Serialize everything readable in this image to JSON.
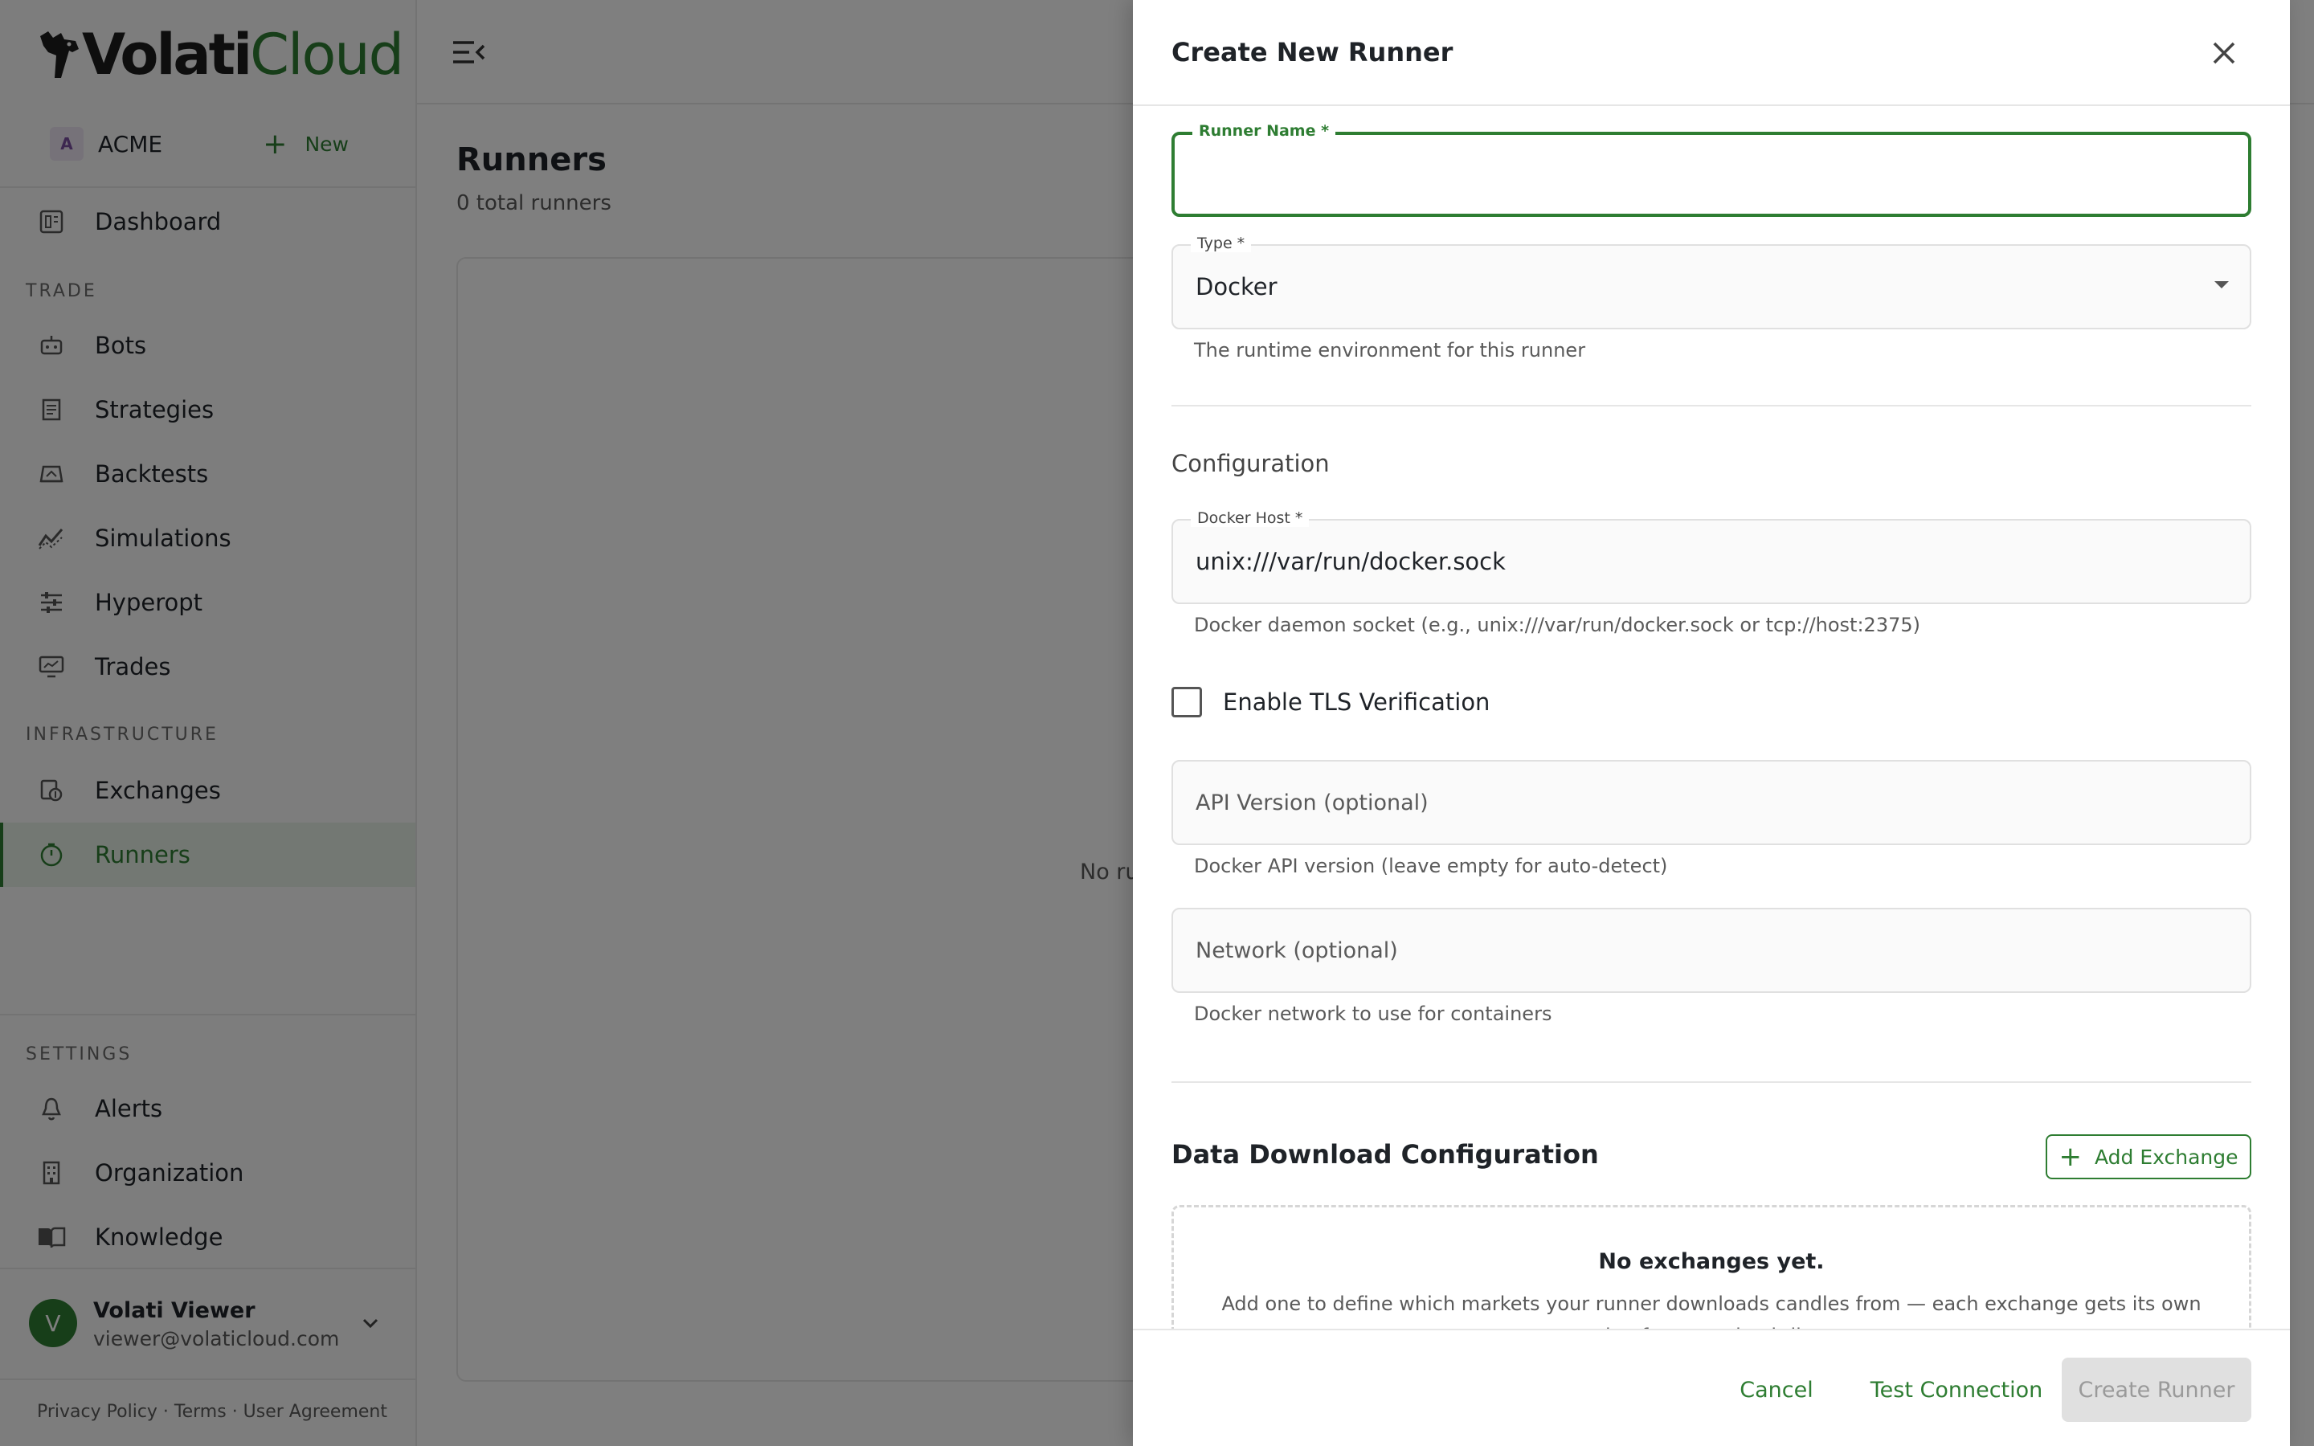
{
  "app": {
    "logo_bold": "Volati",
    "logo_light": "Cloud"
  },
  "org": {
    "avatar_letter": "A",
    "name": "ACME",
    "new_label": "New"
  },
  "sidebar": {
    "dashboard": "Dashboard",
    "trade_label": "TRADE",
    "trade_items": [
      "Bots",
      "Strategies",
      "Backtests",
      "Simulations",
      "Hyperopt",
      "Trades"
    ],
    "infra_label": "INFRASTRUCTURE",
    "infra_items": [
      "Exchanges",
      "Runners"
    ],
    "settings_label": "SETTINGS",
    "settings_items": [
      "Alerts",
      "Organization",
      "Knowledge"
    ]
  },
  "user": {
    "avatar_letter": "V",
    "name": "Volati Viewer",
    "email": "viewer@volaticloud.com"
  },
  "footer": {
    "links": "Privacy Policy · Terms · User Agreement"
  },
  "page": {
    "title": "Runners",
    "subtitle": "0 total runners",
    "empty_text": "No ru"
  },
  "drawer": {
    "title": "Create New Runner",
    "runner_name_label": "Runner Name *",
    "runner_name_value": "",
    "type_label": "Type *",
    "type_value": "Docker",
    "type_helper": "The runtime environment for this runner",
    "config_heading": "Configuration",
    "docker_host_label": "Docker Host *",
    "docker_host_value": "unix:///var/run/docker.sock",
    "docker_host_helper": "Docker daemon socket (e.g., unix:///var/run/docker.sock or tcp://host:2375)",
    "tls_label": "Enable TLS Verification",
    "api_version_placeholder": "API Version (optional)",
    "api_version_helper": "Docker API version (leave empty for auto-detect)",
    "network_placeholder": "Network (optional)",
    "network_helper": "Docker network to use for containers",
    "download_heading": "Data Download Configuration",
    "add_exchange_label": "Add Exchange",
    "no_exchanges_title": "No exchanges yet.",
    "no_exchanges_desc": "Add one to define which markets your runner downloads candles from — each exchange gets its own timeframe and pair list.",
    "cancel_label": "Cancel",
    "test_label": "Test Connection",
    "create_label": "Create Runner"
  },
  "colors": {
    "accent": "#2e7d32",
    "active_bg": "#e7f1e7",
    "disabled_bg": "#e0e0e0"
  },
  "icons": {
    "dashboard": "dashboard-icon",
    "bots": "robot-icon",
    "strategies": "receipt-icon",
    "backtests": "backtest-icon",
    "simulations": "chart-line-icon",
    "hyperopt": "tune-icon",
    "trades": "monitor-chart-icon",
    "exchanges": "exchange-icon",
    "runners": "runner-icon",
    "alerts": "bell-icon",
    "organization": "building-icon",
    "knowledge": "book-icon"
  }
}
